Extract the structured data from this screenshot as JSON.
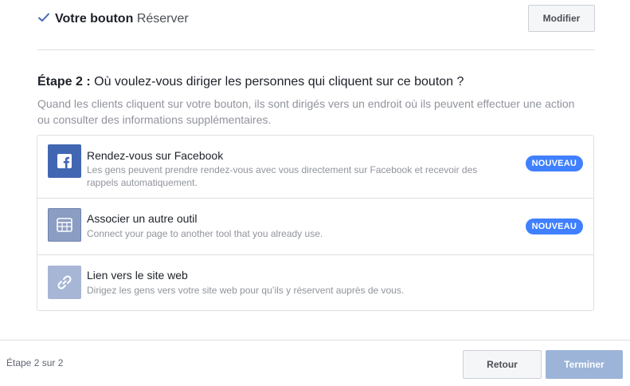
{
  "step1": {
    "title_bold": "Votre bouton",
    "title_value": "Réserver",
    "modify_label": "Modifier"
  },
  "step2": {
    "heading_bold": "Étape 2 :",
    "heading_text": "Où voulez-vous diriger les personnes qui cliquent sur ce bouton ?",
    "description": "Quand les clients cliquent sur votre bouton, ils sont dirigés vers un endroit où ils peuvent effectuer une action ou consulter des informations supplémentaires."
  },
  "options": [
    {
      "title": "Rendez-vous sur Facebook",
      "description": "Les gens peuvent prendre rendez-vous avec vous directement sur Facebook et recevoir des rappels automatiquement.",
      "badge": "NOUVEAU",
      "icon": "facebook-icon",
      "icon_bg": "#4267b2"
    },
    {
      "title": "Associer un autre outil",
      "description": "Connect your page to another tool that you already use.",
      "badge": "NOUVEAU",
      "icon": "calendar-grid-icon",
      "icon_bg": "#8b9dc3"
    },
    {
      "title": "Lien vers le site web",
      "description": "Dirigez les gens vers votre site web pour qu’ils y réservent auprès de vous.",
      "badge": "",
      "icon": "link-icon",
      "icon_bg": "#a8b6d6"
    }
  ],
  "footer": {
    "step_count": "Étape 2 sur 2",
    "back_label": "Retour",
    "finish_label": "Terminer"
  },
  "colors": {
    "accent": "#4080ff",
    "check": "#4267b2",
    "finish_disabled": "#9cb4d8"
  }
}
